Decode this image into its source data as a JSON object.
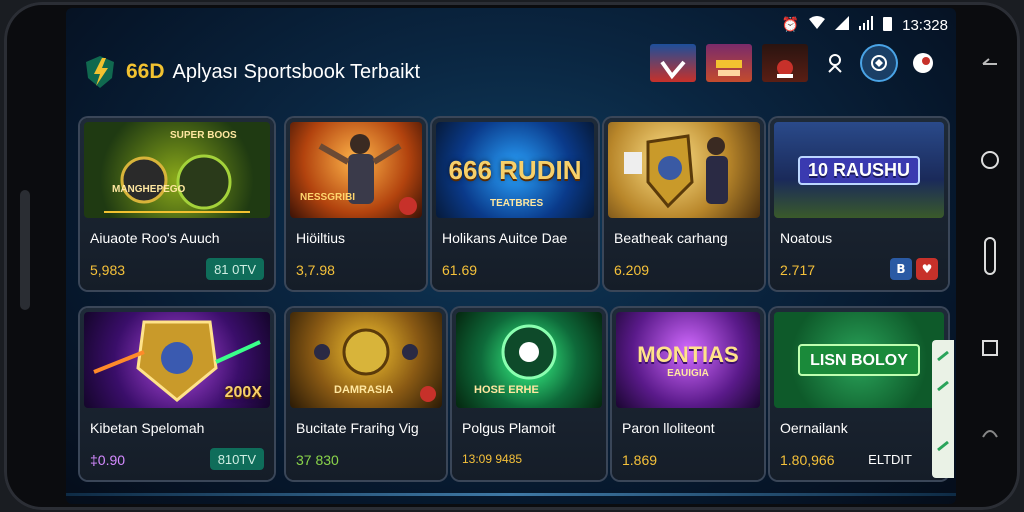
{
  "status": {
    "time": "13:328"
  },
  "header": {
    "brand": "66D",
    "title": "Aplyası Sportsbook Terbaikt",
    "thumbs": [
      {
        "label": "",
        "color": "#c7312a",
        "icon": "flag-thumb-icon"
      },
      {
        "label": "",
        "color": "#7a2b6b",
        "icon": "promo-thumb-icon"
      },
      {
        "label": "",
        "color": "#2a1410",
        "icon": "mascot-thumb-icon"
      }
    ]
  },
  "cards": [
    {
      "name": "Aiuaote Roo's Auuch",
      "odds": "5,983",
      "badge": "81 0TV",
      "banner": "SUPER BOOS",
      "sub": "MANGHEPEGO",
      "theme": "green"
    },
    {
      "name": "Hiöiltius",
      "odds": "3,7.98",
      "badge": "",
      "banner": "",
      "sub": "NESSGRIBI",
      "theme": "fire"
    },
    {
      "name": "Holikans Auitce Dae",
      "odds": "61.69",
      "badge": "",
      "banner": "666 RUDIN",
      "sub": "TEATBRES",
      "theme": "blue"
    },
    {
      "name": "Beatheak carhang",
      "odds": "6.209",
      "badge": "",
      "banner": "",
      "sub": "",
      "theme": "gold"
    },
    {
      "name": "Noatous",
      "odds": "2.717",
      "badge": "",
      "banner": "10 RAUSHU",
      "sub": "",
      "theme": "stadium"
    },
    {
      "name": "Kibetan Spelomah",
      "odds": "‡0.90",
      "badge": "810TV",
      "banner": "200X",
      "sub": "",
      "theme": "purple"
    },
    {
      "name": "Bucitate Frarihg Vig",
      "odds": "37 830",
      "badge": "",
      "banner": "",
      "sub": "DAMRASIA",
      "theme": "shield"
    },
    {
      "name": "Polgus Plamoit",
      "odds": "13:09 9485",
      "badge": "",
      "banner": "HOSE ERHE",
      "sub": "",
      "theme": "emerald"
    },
    {
      "name": "Paron lloliteont",
      "odds": "1.869",
      "badge": "",
      "banner": "MONTIAS",
      "sub": "EAUIGIA",
      "theme": "violet"
    },
    {
      "name": "Oernailank",
      "odds": "1.80,966",
      "badge": "ELTDIT",
      "banner": "LISN BOLOY",
      "sub": "",
      "theme": "felt"
    }
  ],
  "colors": {
    "accent": "#f2c230",
    "badge": "#0f6d5a"
  }
}
